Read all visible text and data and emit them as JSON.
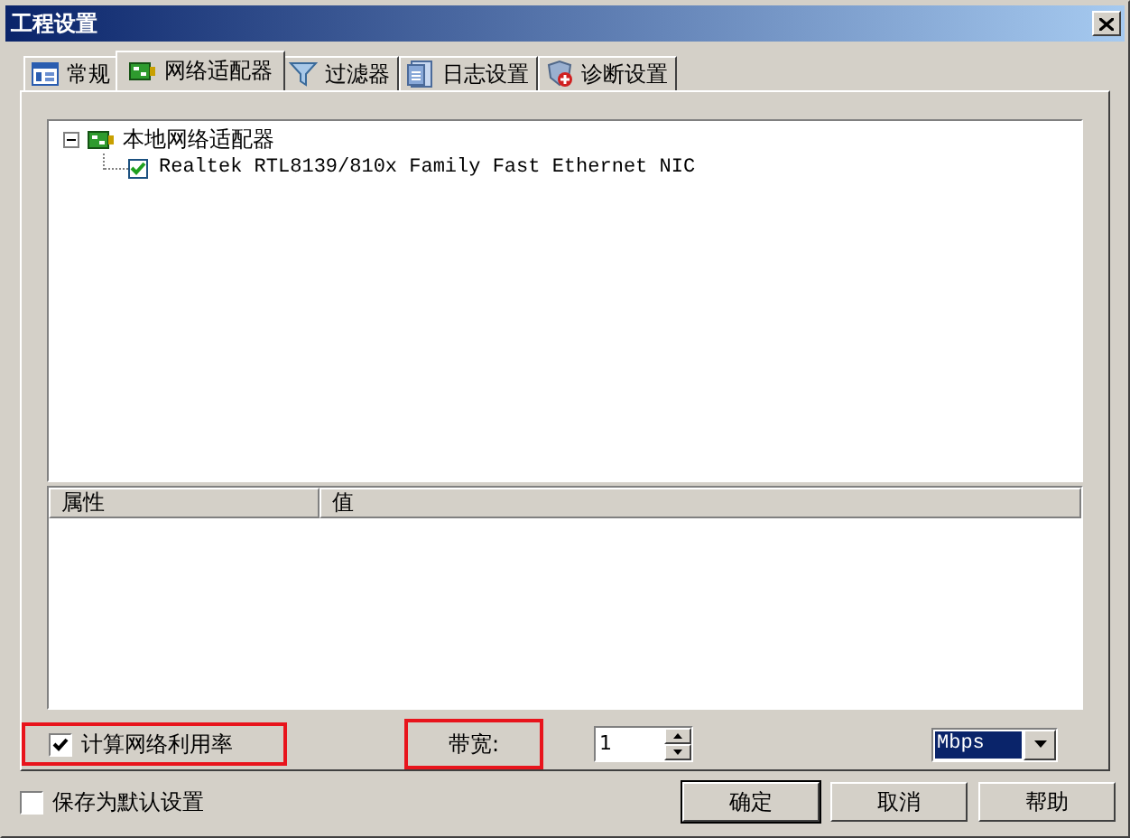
{
  "window": {
    "title": "工程设置"
  },
  "tabs": [
    {
      "label": "常规",
      "selected": false
    },
    {
      "label": "网络适配器",
      "selected": true
    },
    {
      "label": "过滤器",
      "selected": false
    },
    {
      "label": "日志设置",
      "selected": false
    },
    {
      "label": "诊断设置",
      "selected": false
    }
  ],
  "tree": [
    {
      "label": "本地网络适配器",
      "expanded": true,
      "children": [
        {
          "label": "Realtek RTL8139/810x Family Fast Ethernet NIC",
          "checked": true
        }
      ]
    }
  ],
  "properties": {
    "columns": [
      "属性",
      "值"
    ]
  },
  "calc_usage": {
    "label": "计算网络利用率",
    "checked": true,
    "highlighted": true
  },
  "bandwidth": {
    "label": "带宽:",
    "highlighted": true,
    "value": "1",
    "unit": "Mbps"
  },
  "save_default": {
    "label": "保存为默认设置",
    "checked": false
  },
  "buttons": [
    "确定",
    "取消",
    "帮助"
  ]
}
